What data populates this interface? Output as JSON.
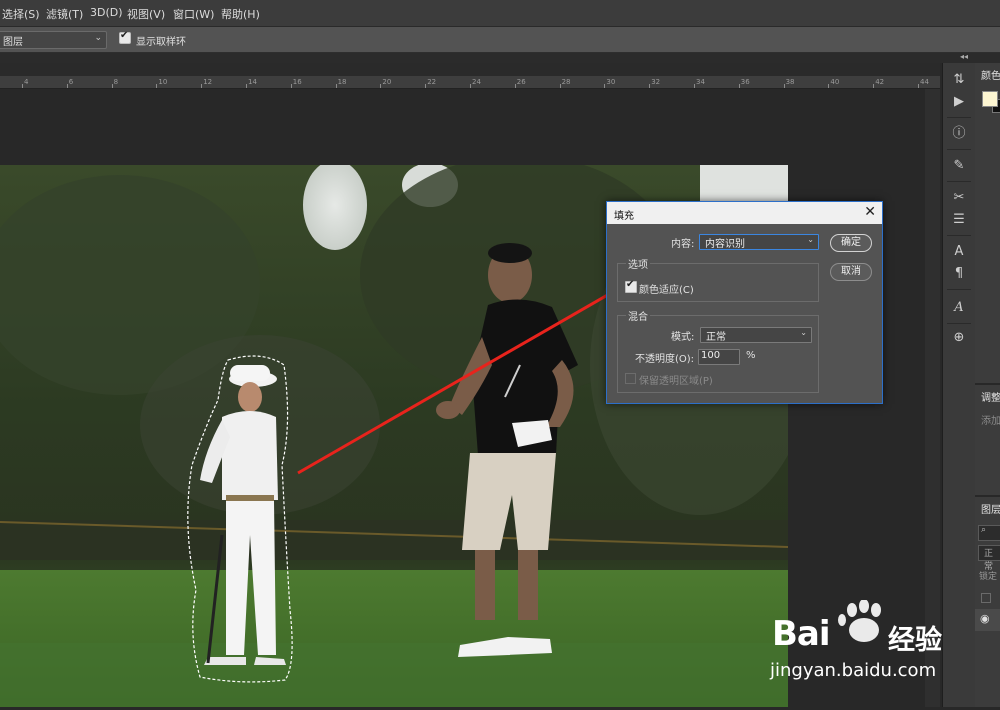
{
  "menu": [
    "选择(S)",
    "滤镜(T)",
    "3D(D)",
    "视图(V)",
    "窗口(W)",
    "帮助(H)"
  ],
  "options": {
    "layer_select_value": "图层",
    "show_ring_label": "显示取样环",
    "show_ring_checked": true
  },
  "ruler_ticks": [
    "4",
    "6",
    "8",
    "10",
    "12",
    "14",
    "16",
    "18",
    "20",
    "22",
    "24",
    "26",
    "28",
    "30",
    "32",
    "34",
    "36",
    "38",
    "40",
    "42",
    "44"
  ],
  "panels": {
    "color_title": "颜色",
    "adjust_title": "调整",
    "adjust_sub": "添加",
    "layers_title": "图层",
    "layers_mode": "正常",
    "layers_lock": "锁定"
  },
  "dialog": {
    "title": "填充",
    "content_label": "内容:",
    "content_value": "内容识别",
    "options_group": "选项",
    "color_adapt_label": "颜色适应(C)",
    "color_adapt_checked": true,
    "blend_group": "混合",
    "mode_label": "模式:",
    "mode_value": "正常",
    "opacity_label": "不透明度(O):",
    "opacity_value": "100",
    "opacity_unit": "%",
    "preserve_label": "保留透明区域(P)",
    "ok_label": "确定",
    "cancel_label": "取消"
  },
  "watermark": {
    "brand": "Bai",
    "brand_cn": "经验",
    "url": "jingyan.baidu.com"
  },
  "colors": {
    "accent_red": "#e8231c",
    "dialog_border": "#2c6fc9",
    "foreground_swatch": "#fdf6d2"
  }
}
